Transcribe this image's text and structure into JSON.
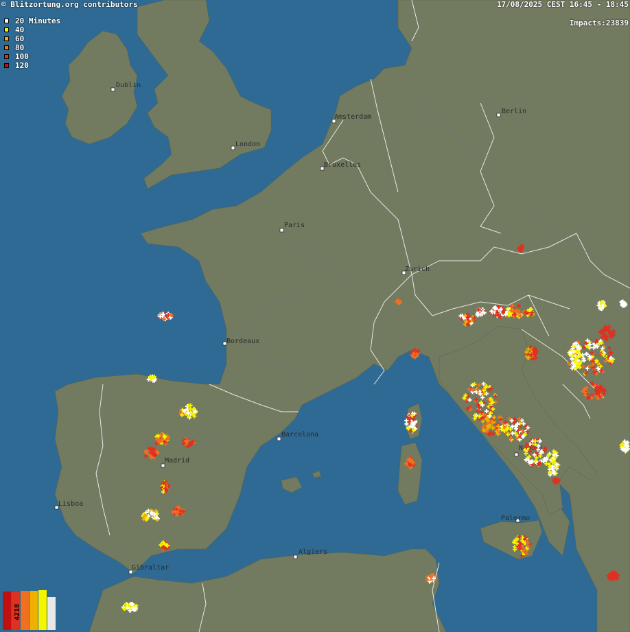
{
  "header": {
    "credit": "© Blitzortung.org contributors",
    "time_range": "17/08/2025 CEST 16:45 - 18:45",
    "impacts": "Impacts:23839"
  },
  "legend": {
    "items": [
      {
        "label": "20 Minutes",
        "color": "#ffffff"
      },
      {
        "label": "40",
        "color": "#f5f500"
      },
      {
        "label": "60",
        "color": "#f0b000"
      },
      {
        "label": "80",
        "color": "#f07020"
      },
      {
        "label": "100",
        "color": "#e03020"
      },
      {
        "label": "120",
        "color": "#c01010"
      }
    ]
  },
  "histogram": {
    "value": "4218",
    "bars": [
      {
        "color": "#c01010",
        "level": 0.97
      },
      {
        "color": "#e03020",
        "level": 0.95
      },
      {
        "color": "#f07020",
        "level": 0.99
      },
      {
        "color": "#f0b000",
        "level": 0.98
      },
      {
        "color": "#f5f500",
        "level": 1.0
      },
      {
        "color": "#e8e8e8",
        "level": 0.82
      }
    ]
  },
  "cities": [
    "Dublin",
    "London",
    "Amsterdam",
    "Bruxelles",
    "Berlin",
    "Paris",
    "Zurich",
    "Bordeaux",
    "Barcelona",
    "Madrid",
    "Lisboa",
    "Gibraltar",
    "Algiers",
    "Napoli",
    "Palermo"
  ],
  "colors": {
    "sea": "#2e6a93",
    "land": "#727a5f",
    "border": "#e8e8e8",
    "river": "#2e6a93"
  }
}
